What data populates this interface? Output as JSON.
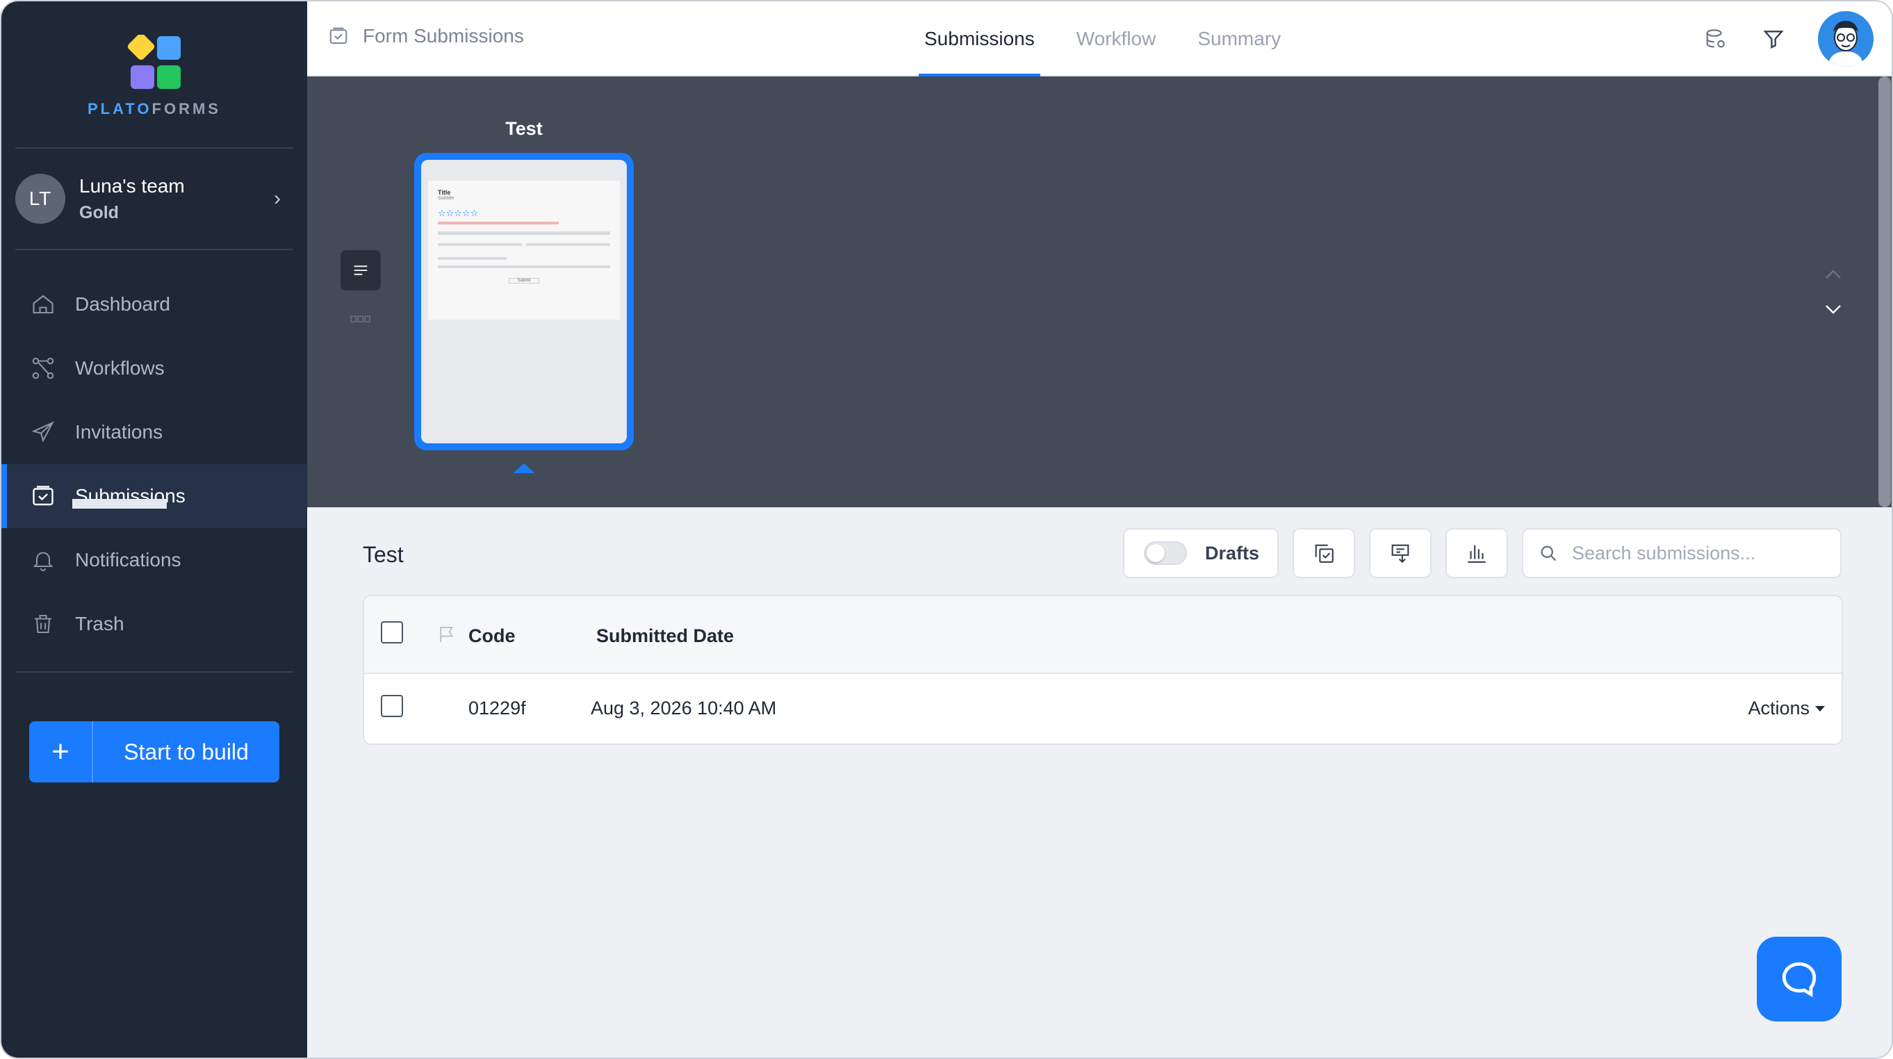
{
  "brand": {
    "logo_part1": "PLATO",
    "logo_part2": "FORMS",
    "colors": {
      "accent": "#1a7bff",
      "sidebar": "#1f2837",
      "preview_bg": "#434a58"
    }
  },
  "team": {
    "initials": "LT",
    "name": "Luna's team",
    "plan": "Gold"
  },
  "sidebar": {
    "items": [
      {
        "label": "Dashboard",
        "icon": "home-icon"
      },
      {
        "label": "Workflows",
        "icon": "workflow-icon"
      },
      {
        "label": "Invitations",
        "icon": "paper-plane-icon"
      },
      {
        "label": "Submissions",
        "icon": "inbox-check-icon",
        "active": true
      },
      {
        "label": "Notifications",
        "icon": "bell-icon"
      },
      {
        "label": "Trash",
        "icon": "trash-icon"
      }
    ],
    "build_button": {
      "icon": "+",
      "label": "Start to build"
    }
  },
  "header": {
    "breadcrumb": "Form Submissions",
    "tabs": [
      {
        "label": "Submissions",
        "active": true
      },
      {
        "label": "Workflow"
      },
      {
        "label": "Summary"
      }
    ],
    "icons": [
      "database-settings-icon",
      "filter-icon",
      "user-avatar"
    ]
  },
  "preview": {
    "card_title": "Test",
    "mini_form": {
      "title": "Title",
      "subtitle": "Subtitle",
      "stars": "☆☆☆☆☆",
      "button": "Submit"
    }
  },
  "submissions": {
    "title": "Test",
    "drafts_label": "Drafts",
    "drafts_enabled": false,
    "search_placeholder": "Search submissions...",
    "columns": [
      "Code",
      "Submitted Date"
    ],
    "rows": [
      {
        "code": "01229f",
        "submitted": "Aug 3, 2026 10:40 AM",
        "actions": "Actions"
      }
    ]
  }
}
